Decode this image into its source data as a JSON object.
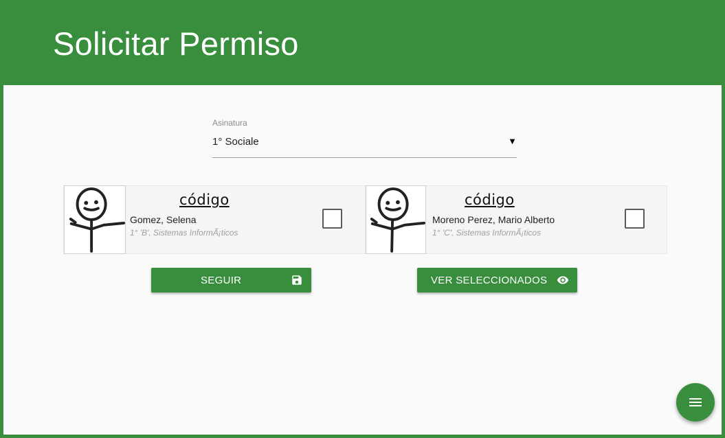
{
  "header": {
    "title": "Solicitar Permiso"
  },
  "select": {
    "label": "Asinatura",
    "value": "1° Sociale",
    "arrow": "▼"
  },
  "students": [
    {
      "code": "código",
      "name": "Gomez, Selena",
      "detail": "1° 'B', Sistemas InformÃ¡ticos",
      "checked": false
    },
    {
      "code": "código",
      "name": "Moreno Perez, Mario Alberto",
      "detail": "1° 'C', Sistemas InformÃ¡ticos",
      "checked": false
    }
  ],
  "buttons": {
    "seguir": {
      "label": "SEGUIR",
      "icon": "save-icon"
    },
    "ver": {
      "label": "VER SELECCIONADOS",
      "icon": "eye-icon"
    }
  },
  "fab": {
    "icon": "menu-icon"
  },
  "colors": {
    "primary": "#388e3c",
    "background": "#fafafa"
  }
}
